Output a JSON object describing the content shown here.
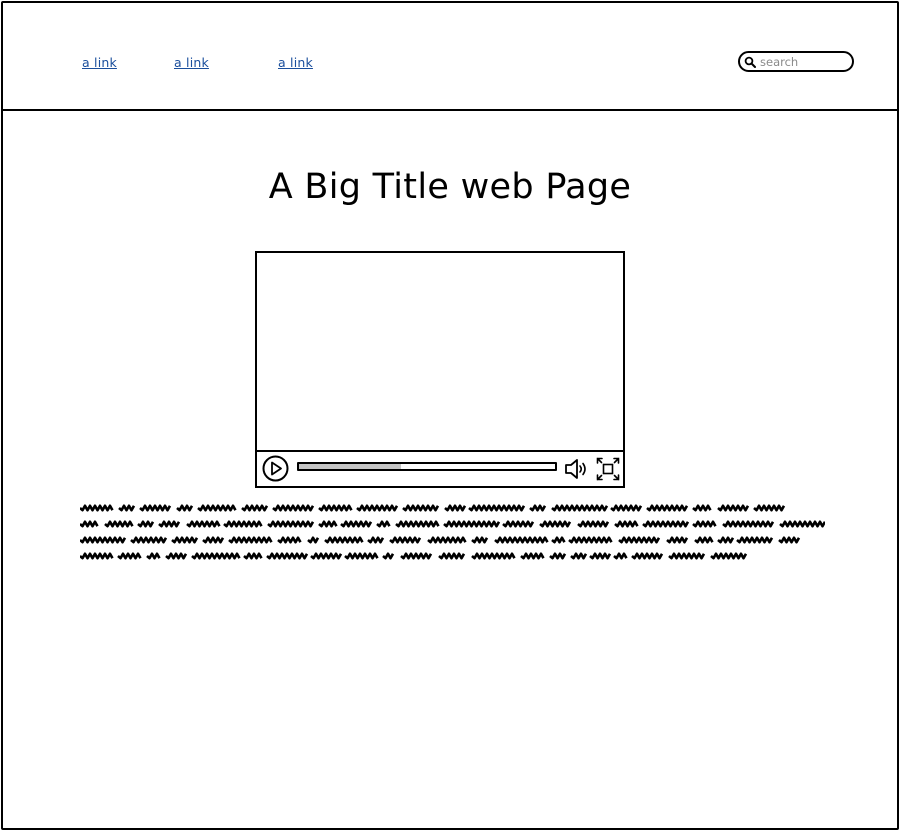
{
  "header": {
    "nav_links": [
      "a link",
      "a link",
      "a link"
    ],
    "search": {
      "placeholder": "search"
    }
  },
  "main": {
    "title": "A Big Title web Page",
    "video": {
      "progress_fraction": 0.4,
      "controls": [
        "play-icon",
        "volume-icon",
        "fullscreen-icon"
      ]
    },
    "paragraph_icon": "scribbled-placeholder-text"
  },
  "colors": {
    "link": "#1a4e9c",
    "progress_fill": "#c4c4c4",
    "outline": "#000000"
  }
}
